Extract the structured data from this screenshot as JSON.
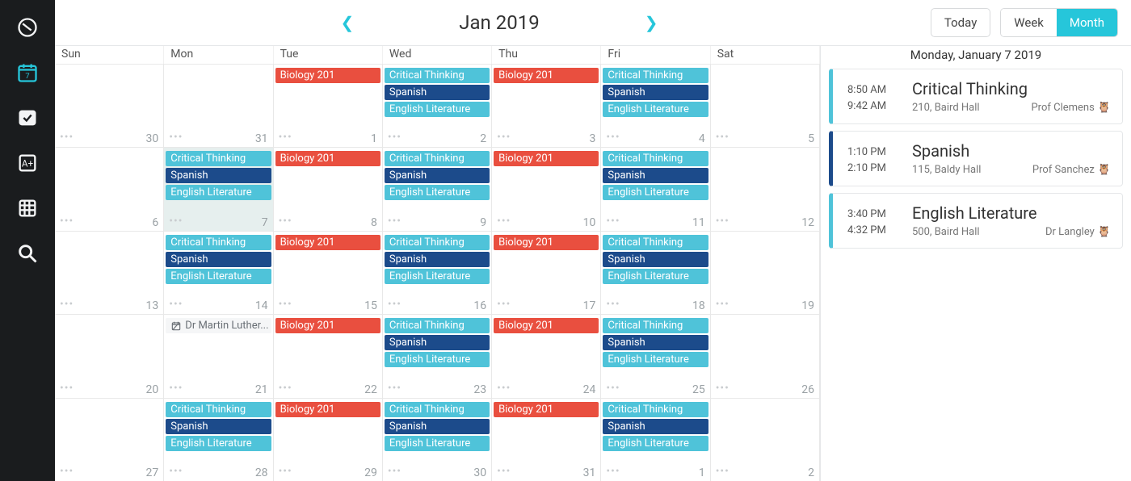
{
  "nav": {
    "items": [
      "dashboard",
      "calendar",
      "tasks",
      "grades",
      "agenda",
      "search"
    ],
    "active": 1
  },
  "header": {
    "title": "Jan 2019",
    "today_label": "Today",
    "week_label": "Week",
    "month_label": "Month",
    "active_view": "month"
  },
  "agenda": {
    "date_label": "Monday, January 7 2019",
    "items": [
      {
        "start": "8:50 AM",
        "end": "9:42 AM",
        "title": "Critical Thinking",
        "room": "210, Baird Hall",
        "instructor": "Prof Clemens",
        "color": "light"
      },
      {
        "start": "1:10 PM",
        "end": "2:10 PM",
        "title": "Spanish",
        "room": "115, Baldy Hall",
        "instructor": "Prof Sanchez",
        "color": "dark"
      },
      {
        "start": "3:40 PM",
        "end": "4:32 PM",
        "title": "English Literature",
        "room": "500, Baird Hall",
        "instructor": "Dr Langley",
        "color": "light"
      }
    ]
  },
  "calendar": {
    "dow": [
      "Sun",
      "Mon",
      "Tue",
      "Wed",
      "Thu",
      "Fri",
      "Sat"
    ],
    "class_bundles": {
      "mwf": [
        {
          "label": "Critical Thinking",
          "color": "light"
        },
        {
          "label": "Spanish",
          "color": "dark"
        },
        {
          "label": "English Literature",
          "color": "light"
        }
      ],
      "tth": [
        {
          "label": "Biology 201",
          "color": "red"
        }
      ]
    },
    "holiday_label": "Dr Martin Luther...",
    "weeks": [
      [
        {
          "num": 30,
          "other": true
        },
        {
          "num": 31,
          "other": true
        },
        {
          "num": 1
        },
        {
          "num": 2
        },
        {
          "num": 3
        },
        {
          "num": 4
        },
        {
          "num": 5
        }
      ],
      [
        {
          "num": 6
        },
        {
          "num": 7,
          "selected": true,
          "bundle": "mwf"
        },
        {
          "num": 8,
          "bundle": "tth"
        },
        {
          "num": 9,
          "bundle": "mwf"
        },
        {
          "num": 10,
          "bundle": "tth"
        },
        {
          "num": 11,
          "bundle": "mwf"
        },
        {
          "num": 12
        }
      ],
      [
        {
          "num": 13
        },
        {
          "num": 14,
          "bundle": "mwf"
        },
        {
          "num": 15,
          "bundle": "tth"
        },
        {
          "num": 16,
          "bundle": "mwf"
        },
        {
          "num": 17,
          "bundle": "tth"
        },
        {
          "num": 18,
          "bundle": "mwf"
        },
        {
          "num": 19
        }
      ],
      [
        {
          "num": 20
        },
        {
          "num": 21,
          "holiday": true
        },
        {
          "num": 22,
          "bundle": "tth"
        },
        {
          "num": 23,
          "bundle": "mwf"
        },
        {
          "num": 24,
          "bundle": "tth"
        },
        {
          "num": 25,
          "bundle": "mwf"
        },
        {
          "num": 26
        }
      ],
      [
        {
          "num": 27
        },
        {
          "num": 28,
          "bundle": "mwf"
        },
        {
          "num": 29,
          "bundle": "tth"
        },
        {
          "num": 30,
          "bundle": "mwf"
        },
        {
          "num": 31,
          "bundle": "tth"
        },
        {
          "num": 1,
          "other": true,
          "bundle": "mwf"
        },
        {
          "num": 2,
          "other": true
        }
      ]
    ],
    "first_week_bundles": [
      null,
      null,
      "tth",
      "mwf",
      "tth",
      "mwf",
      null
    ]
  }
}
